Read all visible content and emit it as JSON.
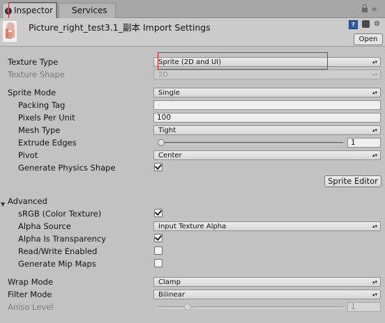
{
  "tabs": {
    "inspector": "Inspector",
    "services": "Services"
  },
  "header": {
    "asset_title": "Picture_right_test3.1_副本 Import Settings",
    "open_label": "Open"
  },
  "icons": {
    "info": "info-icon",
    "lock": "lock-icon",
    "menu": "kebab-menu-icon",
    "help": "help-icon",
    "settings": "settings-icon",
    "dropdown_arrow": "▴▾"
  },
  "colors": {
    "highlight": "#e02020"
  },
  "texture": {
    "type_label": "Texture Type",
    "type_value": "Sprite (2D and UI)",
    "shape_label": "Texture Shape",
    "shape_value": "2D"
  },
  "sprite": {
    "mode_label": "Sprite Mode",
    "mode_value": "Single",
    "packing_tag_label": "Packing Tag",
    "packing_tag_value": "",
    "ppu_label": "Pixels Per Unit",
    "ppu_value": "100",
    "mesh_type_label": "Mesh Type",
    "mesh_type_value": "Tight",
    "extrude_label": "Extrude Edges",
    "extrude_value": "1",
    "pivot_label": "Pivot",
    "pivot_value": "Center",
    "physics_label": "Generate Physics Shape",
    "physics_checked": true,
    "editor_button": "Sprite Editor"
  },
  "advanced": {
    "header": "Advanced",
    "srgb_label": "sRGB (Color Texture)",
    "srgb_checked": true,
    "alpha_source_label": "Alpha Source",
    "alpha_source_value": "Input Texture Alpha",
    "alpha_transparency_label": "Alpha Is Transparency",
    "alpha_transparency_checked": true,
    "readwrite_label": "Read/Write Enabled",
    "readwrite_checked": false,
    "mipmaps_label": "Generate Mip Maps",
    "mipmaps_checked": false
  },
  "wrap": {
    "label": "Wrap Mode",
    "value": "Clamp"
  },
  "filter": {
    "label": "Filter Mode",
    "value": "Bilinear"
  },
  "aniso": {
    "label": "Aniso Level",
    "value": "1"
  }
}
